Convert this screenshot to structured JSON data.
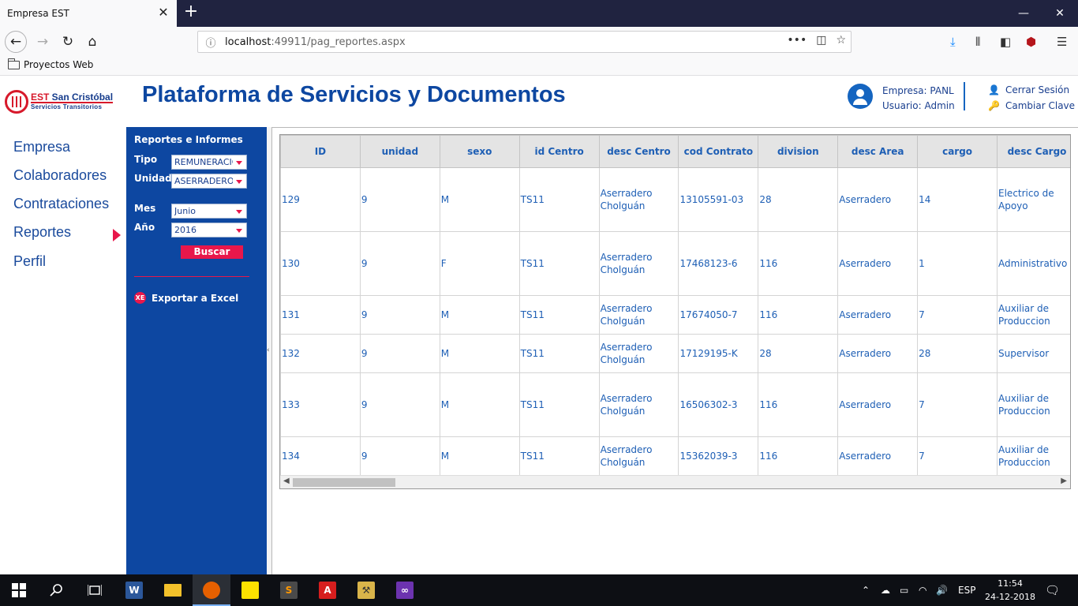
{
  "browser": {
    "tab_title": "Empresa EST",
    "tab_close": "✕",
    "new_tab": "+",
    "url_host": "localhost",
    "url_rest": ":49911/pag_reportes.aspx",
    "bookmark": "Proyectos Web",
    "window_buttons": [
      "—",
      "❐",
      "✕"
    ]
  },
  "header": {
    "logo_line1_brand": "EST",
    "logo_line1_rest": " San Cristóbal",
    "logo_line2": "Servicios Transitorios",
    "title": "Plataforma de Servicios y Documentos",
    "empresa": "Empresa: PANL",
    "usuario": "Usuario: Admin",
    "logout": "Cerrar Sesión",
    "change_password": "Cambiar Clave"
  },
  "nav": {
    "items": [
      "Empresa",
      "Colaboradores",
      "Contrataciones",
      "Reportes",
      "Perfil"
    ],
    "active": "Reportes"
  },
  "filters": {
    "title": "Reportes e Informes",
    "tipo_label": "Tipo",
    "tipo_value": "REMUNERACIONES",
    "unidad_label": "Unidad",
    "unidad_value": "ASERRADERO",
    "mes_label": "Mes",
    "mes_value": "Junio",
    "anio_label": "Año",
    "anio_value": "2016",
    "search_button": "Buscar",
    "export_icon": "XE",
    "export_label": "Exportar a Excel"
  },
  "grid": {
    "columns": [
      "ID",
      "unidad",
      "sexo",
      "id Centro",
      "desc Centro",
      "cod Contrato",
      "division",
      "desc Area",
      "cargo",
      "desc Cargo"
    ],
    "rows": [
      [
        "129",
        "9",
        "M",
        "TS11",
        "Aserradero Cholguán",
        "13105591-03",
        "28",
        "Aserradero",
        "14",
        "Electrico de Apoyo"
      ],
      [
        "130",
        "9",
        "F",
        "TS11",
        "Aserradero Cholguán",
        "17468123-6",
        "116",
        "Aserradero",
        "1",
        "Administrativo"
      ],
      [
        "131",
        "9",
        "M",
        "TS11",
        "Aserradero Cholguán",
        "17674050-7",
        "116",
        "Aserradero",
        "7",
        "Auxiliar de Produccion"
      ],
      [
        "132",
        "9",
        "M",
        "TS11",
        "Aserradero Cholguán",
        "17129195-K",
        "28",
        "Aserradero",
        "28",
        "Supervisor"
      ],
      [
        "133",
        "9",
        "M",
        "TS11",
        "Aserradero Cholguán",
        "16506302-3",
        "116",
        "Aserradero",
        "7",
        "Auxiliar de Produccion"
      ],
      [
        "134",
        "9",
        "M",
        "TS11",
        "Aserradero Cholguán",
        "15362039-3",
        "116",
        "Aserradero",
        "7",
        "Auxiliar de Produccion"
      ]
    ]
  },
  "taskbar": {
    "language": "ESP",
    "time": "11:54",
    "date": "24-12-2018",
    "apps": [
      "start",
      "search",
      "task-view",
      "word",
      "file-explorer",
      "firefox",
      "sticky-notes",
      "sublime-text",
      "acrobat",
      "tool",
      "visual-studio"
    ]
  },
  "colors": {
    "brand_blue": "#0d47a1",
    "accent_red": "#e8174b",
    "link_blue": "#1e5fb5"
  }
}
